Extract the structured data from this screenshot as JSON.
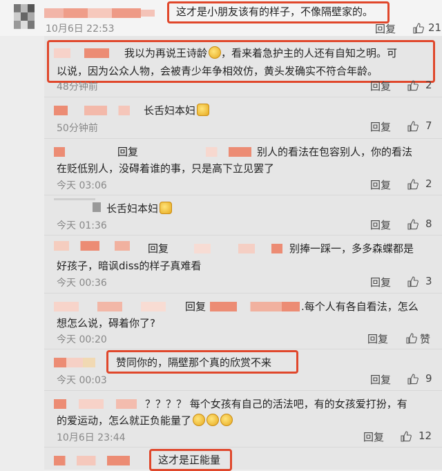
{
  "comments": [
    {
      "text": "这才是小朋友该有的样子，不像隔壁家的。",
      "time": "10月6日 22:53",
      "reply_label": "回复",
      "likes": "21"
    },
    {
      "text_line1": "我以为再说王诗龄",
      "text_line1b": "，看来着急护主的人还有自知之明。可",
      "text_line2": "以说，因为公众人物，会被青少年争相效仿，黄头发确实不符合年龄。",
      "time": "48分钟前",
      "reply_label": "回复",
      "likes": "2"
    },
    {
      "text": "长舌妇本妇",
      "time": "50分钟前",
      "reply_label": "回复",
      "likes": "7"
    },
    {
      "prefix": "回复",
      "text_line1": "别人的看法在包容别人，你的看法",
      "text_line2": "在贬低别人，没碍着谁的事，只是高下立见罢了",
      "time": "今天 03:06",
      "reply_label": "回复",
      "likes": "2"
    },
    {
      "text": "长舌妇本妇",
      "time": "今天 01:36",
      "reply_label": "回复",
      "likes": "8"
    },
    {
      "prefix": "回复",
      "text_line1": "别捧一踩一，多多森蝶都是",
      "text_line2": "好孩子，暗讽diss的样子真难看",
      "time": "今天 00:36",
      "reply_label": "回复",
      "likes": "3"
    },
    {
      "prefix": "回复",
      "text_line1": ".每个人有各自看法，怎么",
      "text_line2": "想怎么说，碍着你了?",
      "time": "今天 00:20",
      "reply_label": "回复",
      "likes": "赞"
    },
    {
      "text": "赞同你的，隔壁那个真的欣赏不来",
      "time": "今天 00:03",
      "reply_label": "回复",
      "likes": "9"
    },
    {
      "text_line1": "？？？？ 每个女孩有自己的活法吧，有的女孩爱打扮，有",
      "text_line2": "的爱运动，怎么就正负能量了",
      "time": "10月6日 23:44",
      "reply_label": "回复",
      "likes": "12"
    },
    {
      "text": "这才是正能量"
    }
  ],
  "colors": {
    "highlight": "#e0472b",
    "mosaic": "#e8826a"
  }
}
